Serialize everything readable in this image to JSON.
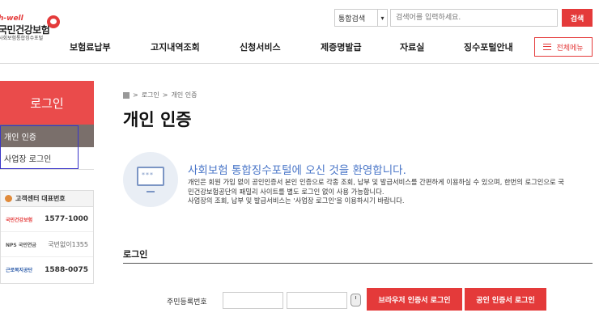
{
  "logo": {
    "tagline": "h-well",
    "name": "국민건강보험",
    "subtitle": "사회보험통합징수포털"
  },
  "search": {
    "select_value": "통합검색",
    "placeholder": "검색어를 입력하세요.",
    "button_label": "검색"
  },
  "nav": {
    "items": [
      "보험료납부",
      "고지내역조회",
      "신청서비스",
      "제증명발급",
      "자료실",
      "징수포털안내"
    ],
    "menu_button": "전체메뉴"
  },
  "sidebar": {
    "title": "로그인",
    "items": [
      {
        "label": "개인 인증",
        "active": true
      },
      {
        "label": "사업장 로그인",
        "active": false
      }
    ]
  },
  "contact": {
    "heading": "고객센터 대표번호",
    "rows": [
      {
        "org": "국민건강보험",
        "number": "1577-1000"
      },
      {
        "org": "NPS 국민연금",
        "number": "국번없이1355"
      },
      {
        "org": "근로복지공단",
        "number": "1588-0075"
      }
    ]
  },
  "breadcrumb": {
    "items": [
      "로그인",
      "개인 인증"
    ]
  },
  "page": {
    "title": "개인 인증"
  },
  "welcome": {
    "title": "사회보험 통합징수포털에 오신 것을 환영합니다.",
    "line1": "개인은 회원 가입 없이 공인인증서 본인 인증으로 각종 조회, 납부 및 발급서비스를 간편하게 이용하실 수 있으며, 한번의 로그인으로 국",
    "line2": "민건강보험공단의 패밀리 사이트를 별도 로그인 없이 사용 가능합니다.",
    "line3": "사업장의 조회, 납부 및 발급서비스는 '사업장 로그인'을 이용하시기 바랍니다."
  },
  "login": {
    "section_label": "로그인",
    "rrn_label": "주민등록번호",
    "browser_button": "브라우저 인증서 로그인",
    "cert_button": "공인 인증서 로그인"
  },
  "colors": {
    "brand_red": "#e43a3a",
    "sidebar_active": "#7a6f6b",
    "welcome_blue": "#4a76c8",
    "highlight_box": "#3a35c8"
  }
}
